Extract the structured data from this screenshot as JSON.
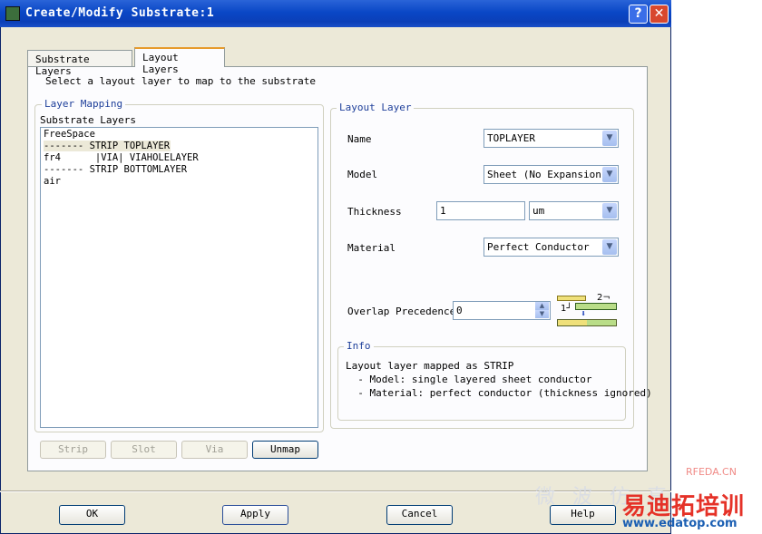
{
  "window": {
    "title": "Create/Modify Substrate:1",
    "help_glyph": "?",
    "close_glyph": "✕"
  },
  "tabs": [
    {
      "label": "Substrate Layers"
    },
    {
      "label": "Layout Layers"
    }
  ],
  "instruction": "Select a layout layer to map to the substrate",
  "layer_mapping": {
    "group_label": "Layer Mapping",
    "list_label": "Substrate Layers",
    "items": [
      "FreeSpace",
      "------- STRIP TOPLAYER",
      "fr4      |VIA| VIAHOLELAYER",
      "------- STRIP BOTTOMLAYER",
      "air"
    ],
    "selected_index": 1,
    "buttons": {
      "strip": "Strip",
      "slot": "Slot",
      "via": "Via",
      "unmap": "Unmap"
    }
  },
  "layout_layer": {
    "group_label": "Layout Layer",
    "name_label": "Name",
    "name_value": "TOPLAYER",
    "model_label": "Model",
    "model_value": "Sheet (No Expansion)",
    "thickness_label": "Thickness",
    "thickness_value": "1",
    "thickness_unit": "um",
    "material_label": "Material",
    "material_value": "Perfect Conductor",
    "overlap_label": "Overlap Precedence",
    "overlap_value": "0",
    "overlap_diagram": {
      "label_top": "2",
      "label_bottom": "1"
    }
  },
  "info": {
    "group_label": "Info",
    "lines": [
      "Layout layer mapped as STRIP",
      "  - Model: single layered sheet conductor",
      "  - Material: perfect conductor (thickness ignored)"
    ]
  },
  "dialog_buttons": {
    "ok": "OK",
    "apply": "Apply",
    "cancel": "Cancel",
    "help": "Help"
  },
  "watermark": {
    "site_tag": "RFEDA.CN",
    "cn_text": "易迪拓培训",
    "url": "www.edatop.com",
    "faint_text": "微 波 仿 真"
  },
  "colors": {
    "titlebar": "#0a47c6",
    "dialog_bg": "#ece9d8",
    "tab_highlight": "#e69b2c",
    "group_label": "#1e3f9a",
    "watermark_red": "#e53228",
    "watermark_blue": "#1b5fb3"
  }
}
